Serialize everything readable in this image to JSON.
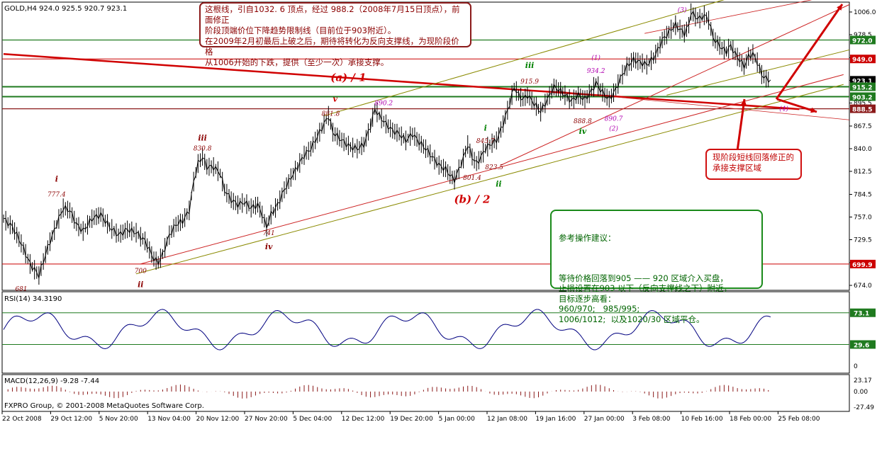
{
  "header": {
    "symbol_line": "GOLD,H4  924.0 925.5 920.7 923.1",
    "rsi_label": "RSI(14) 34.3190",
    "macd_label": "MACD(12,26,9) -9.28 -7.44",
    "copyright": "FXPRO Group, © 2001-2008 MetaQuotes Software Corp."
  },
  "notes": {
    "top": "这根线，引自1032. 6 顶点，经过 988.2（2008年7月15日顶点），前面修正\n阶段顶端价位下降趋势限制线（目前位于903附近）。\n在2009年2月初最后上破之后，期待将转化为反向支撑线，为现阶段价格\n从1006开始的下跌，提供（至少一次）承接支撑。",
    "green_title": "参考操作建议：",
    "green_body": "等待价格回落到905 —— 920 区域介入买盘，\n止损设置在903 以下（反向支撑线之下）附近，\n目标逐步高看：\n960/970;   985/995;\n1006/1012;  以及1020/30 区域平仓。",
    "red": "现阶段短线回落修正的\n承接支撑区域"
  },
  "chart_data": [
    {
      "type": "line",
      "title": "GOLD,H4",
      "ylim": [
        668,
        1018
      ],
      "y_ticks": [
        674.0,
        701.6,
        729.5,
        757.0,
        784.5,
        812.5,
        840.0,
        867.5,
        895.5,
        923.0,
        950.5,
        978.5,
        1006.0
      ],
      "x_tick_labels": [
        "22 Oct 2008",
        "29 Oct 12:00",
        "5 Nov 20:00",
        "13 Nov 04:00",
        "20 Nov 12:00",
        "27 Nov 20:00",
        "5 Dec 04:00",
        "12 Dec 12:00",
        "19 Dec 20:00",
        "5 Jan 00:00",
        "12 Jan 08:00",
        "19 Jan 16:00",
        "27 Jan 00:00",
        "3 Feb 08:00",
        "10 Feb 16:00",
        "18 Feb 00:00",
        "25 Feb 08:00"
      ],
      "price_path": [
        [
          0,
          755
        ],
        [
          4,
          745
        ],
        [
          8,
          725
        ],
        [
          12,
          700
        ],
        [
          16,
          686
        ],
        [
          20,
          720
        ],
        [
          24,
          748
        ],
        [
          27,
          768
        ],
        [
          30,
          765
        ],
        [
          33,
          748
        ],
        [
          36,
          740
        ],
        [
          40,
          755
        ],
        [
          44,
          760
        ],
        [
          48,
          745
        ],
        [
          52,
          735
        ],
        [
          56,
          742
        ],
        [
          60,
          738
        ],
        [
          64,
          728
        ],
        [
          68,
          706
        ],
        [
          70,
          702
        ],
        [
          72,
          712
        ],
        [
          75,
          735
        ],
        [
          78,
          748
        ],
        [
          81,
          752
        ],
        [
          84,
          765
        ],
        [
          86,
          800
        ],
        [
          88,
          822
        ],
        [
          90,
          830
        ],
        [
          92,
          818
        ],
        [
          95,
          818
        ],
        [
          98,
          810
        ],
        [
          100,
          790
        ],
        [
          103,
          778
        ],
        [
          106,
          772
        ],
        [
          109,
          775
        ],
        [
          112,
          768
        ],
        [
          115,
          772
        ],
        [
          117,
          760
        ],
        [
          119,
          745
        ],
        [
          121,
          760
        ],
        [
          124,
          772
        ],
        [
          127,
          790
        ],
        [
          130,
          805
        ],
        [
          133,
          818
        ],
        [
          136,
          832
        ],
        [
          139,
          840
        ],
        [
          142,
          855
        ],
        [
          145,
          870
        ],
        [
          147,
          880
        ],
        [
          149,
          860
        ],
        [
          151,
          855
        ],
        [
          154,
          848
        ],
        [
          157,
          842
        ],
        [
          160,
          840
        ],
        [
          163,
          845
        ],
        [
          166,
          868
        ],
        [
          168,
          888
        ],
        [
          170,
          880
        ],
        [
          173,
          870
        ],
        [
          176,
          862
        ],
        [
          179,
          858
        ],
        [
          182,
          850
        ],
        [
          185,
          858
        ],
        [
          188,
          848
        ],
        [
          191,
          840
        ],
        [
          194,
          830
        ],
        [
          197,
          820
        ],
        [
          200,
          815
        ],
        [
          202,
          808
        ],
        [
          204,
          802
        ],
        [
          206,
          815
        ],
        [
          208,
          828
        ],
        [
          210,
          845
        ],
        [
          212,
          830
        ],
        [
          214,
          822
        ],
        [
          216,
          830
        ],
        [
          218,
          840
        ],
        [
          220,
          845
        ],
        [
          223,
          850
        ],
        [
          226,
          870
        ],
        [
          229,
          895
        ],
        [
          231,
          915
        ],
        [
          233,
          905
        ],
        [
          235,
          900
        ],
        [
          237,
          905
        ],
        [
          240,
          895
        ],
        [
          243,
          885
        ],
        [
          245,
          895
        ],
        [
          247,
          905
        ],
        [
          249,
          915
        ],
        [
          251,
          912
        ],
        [
          254,
          905
        ],
        [
          257,
          898
        ],
        [
          260,
          905
        ],
        [
          263,
          900
        ],
        [
          266,
          910
        ],
        [
          268,
          920
        ],
        [
          270,
          912
        ],
        [
          272,
          905
        ],
        [
          274,
          900
        ],
        [
          277,
          912
        ],
        [
          279,
          925
        ],
        [
          282,
          940
        ],
        [
          285,
          948
        ],
        [
          288,
          945
        ],
        [
          291,
          942
        ],
        [
          294,
          950
        ],
        [
          296,
          960
        ],
        [
          298,
          972
        ],
        [
          300,
          978
        ],
        [
          302,
          985
        ],
        [
          304,
          990
        ],
        [
          306,
          985
        ],
        [
          308,
          980
        ],
        [
          310,
          990
        ],
        [
          311,
          1006
        ],
        [
          313,
          1000
        ],
        [
          315,
          998
        ],
        [
          317,
          1002
        ],
        [
          319,
          996
        ],
        [
          321,
          975
        ],
        [
          323,
          968
        ],
        [
          325,
          962
        ],
        [
          327,
          958
        ],
        [
          329,
          965
        ],
        [
          331,
          955
        ],
        [
          333,
          948
        ],
        [
          335,
          940
        ],
        [
          337,
          952
        ],
        [
          339,
          955
        ],
        [
          341,
          945
        ],
        [
          343,
          930
        ],
        [
          345,
          925
        ],
        [
          347,
          923
        ]
      ],
      "price_path_note": "x = bar index (0-347), y = price",
      "labels": [
        {
          "text": "i",
          "x": 24,
          "y": 800,
          "color": "#8b0000",
          "style": "italic-bold"
        },
        {
          "text": "777.4",
          "x": 24,
          "y": 782,
          "color": "#8b0000"
        },
        {
          "text": "iii",
          "x": 90,
          "y": 850,
          "color": "#8b0000",
          "style": "italic-bold"
        },
        {
          "text": "830.8",
          "x": 90,
          "y": 838,
          "color": "#8b0000"
        },
        {
          "text": "741",
          "x": 120,
          "y": 735,
          "color": "#8b0000"
        },
        {
          "text": "iv",
          "x": 120,
          "y": 718,
          "color": "#8b0000",
          "style": "italic-bold"
        },
        {
          "text": "700",
          "x": 62,
          "y": 689,
          "color": "#8b0000"
        },
        {
          "text": "ii",
          "x": 62,
          "y": 672,
          "color": "#8b0000",
          "style": "italic-bold"
        },
        {
          "text": "681",
          "x": 8,
          "y": 667,
          "color": "#8b0000"
        },
        {
          "text": "(a) / 1",
          "x": 156,
          "y": 922,
          "color": "#d00000",
          "style": "big"
        },
        {
          "text": "v",
          "x": 150,
          "y": 897,
          "color": "#d00000",
          "style": "italic-bold"
        },
        {
          "text": "881.8",
          "x": 148,
          "y": 880,
          "color": "#8b0000"
        },
        {
          "text": "890.2",
          "x": 172,
          "y": 893,
          "color": "#b000b0"
        },
        {
          "text": "(b) / 2",
          "x": 212,
          "y": 774,
          "color": "#d00000",
          "style": "big"
        },
        {
          "text": "i",
          "x": 218,
          "y": 862,
          "color": "#008000",
          "style": "italic-bold"
        },
        {
          "text": "845.7",
          "x": 218,
          "y": 847,
          "color": "#8b0000"
        },
        {
          "text": "823.5",
          "x": 222,
          "y": 815,
          "color": "#8b0000"
        },
        {
          "text": "801.4",
          "x": 212,
          "y": 802,
          "color": "#8b0000"
        },
        {
          "text": "ii",
          "x": 224,
          "y": 794,
          "color": "#008000",
          "style": "italic-bold"
        },
        {
          "text": "iii",
          "x": 238,
          "y": 938,
          "color": "#008000",
          "style": "italic-bold"
        },
        {
          "text": "915.9",
          "x": 238,
          "y": 919,
          "color": "#8b0000"
        },
        {
          "text": "888.8",
          "x": 262,
          "y": 871,
          "color": "#8b0000"
        },
        {
          "text": "iv",
          "x": 262,
          "y": 858,
          "color": "#008000",
          "style": "italic-bold"
        },
        {
          "text": "(1)",
          "x": 268,
          "y": 948,
          "color": "#b000b0"
        },
        {
          "text": "934.2",
          "x": 268,
          "y": 932,
          "color": "#b000b0"
        },
        {
          "text": "890.7",
          "x": 276,
          "y": 874,
          "color": "#b000b0"
        },
        {
          "text": "(2)",
          "x": 276,
          "y": 862,
          "color": "#b000b0"
        },
        {
          "text": "1006",
          "x": 311,
          "y": 1021,
          "color": "#8b0000"
        },
        {
          "text": "(3)",
          "x": 307,
          "y": 1006,
          "color": "#b000b0"
        },
        {
          "text": "(4)",
          "x": 353,
          "y": 886,
          "color": "#b000b0"
        }
      ],
      "price_boxes": [
        {
          "text": "972.0",
          "price": 972.0,
          "color": "#1f7a1f"
        },
        {
          "text": "949.0",
          "price": 949.0,
          "color": "#cc0000"
        },
        {
          "text": "923.1",
          "price": 923.1,
          "color": "#000000"
        },
        {
          "text": "915.2",
          "price": 915.2,
          "color": "#1f7a1f"
        },
        {
          "text": "903.2",
          "price": 903.2,
          "color": "#1f7a1f"
        },
        {
          "text": "888.5",
          "price": 888.5,
          "color": "#8b1a1a"
        },
        {
          "text": "699.9",
          "price": 699.9,
          "color": "#cc0000"
        }
      ]
    },
    {
      "type": "line",
      "title": "RSI(14) 34.3190",
      "ylim": [
        0,
        100
      ],
      "y_ticks": [
        73.1,
        29.6,
        0
      ],
      "levels": [
        73.1,
        29.6
      ]
    },
    {
      "type": "bar",
      "title": "MACD(12,26,9) -9.28 -7.44",
      "y_ticks": [
        23.17,
        0.0,
        -27.49
      ]
    }
  ]
}
